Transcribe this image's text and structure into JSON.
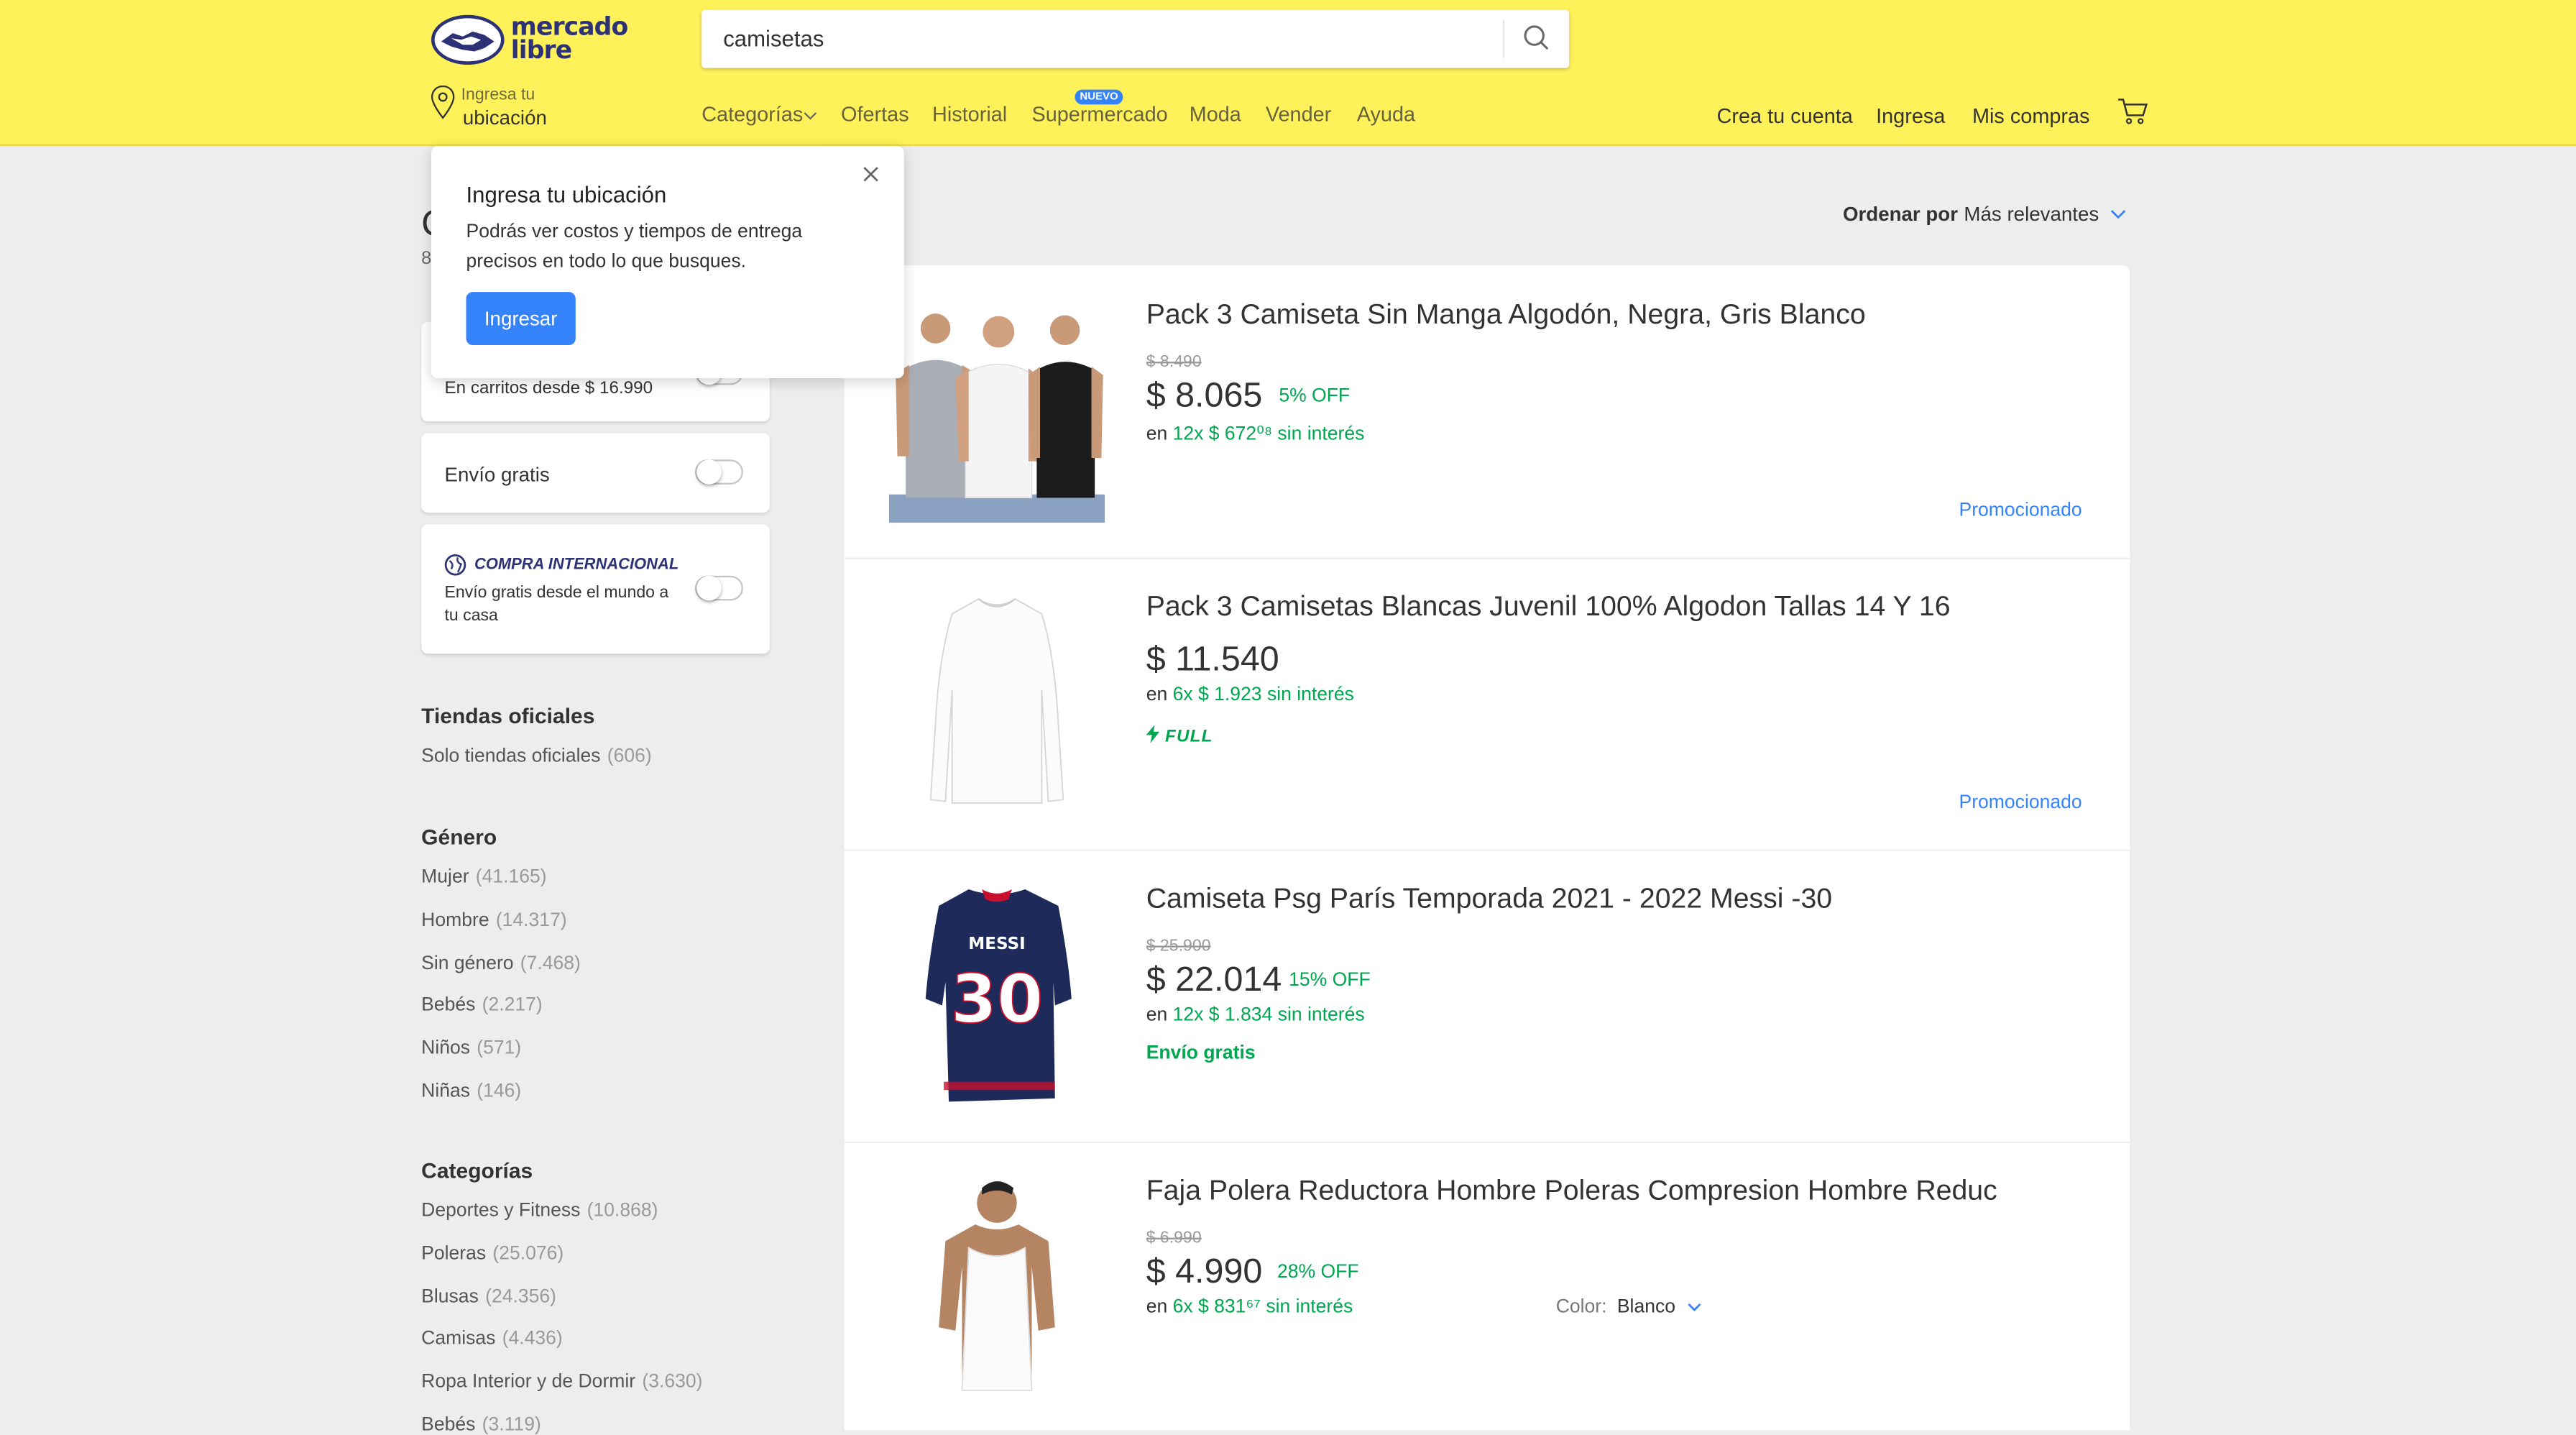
{
  "header": {
    "logo_text": [
      "mercado",
      "libre"
    ],
    "search_value": "camisetas",
    "location_line1": "Ingresa tu",
    "location_line2": "ubicación",
    "nav": [
      "Categorías",
      "Ofertas",
      "Historial",
      "Supermercado",
      "Moda",
      "Vender",
      "Ayuda"
    ],
    "nuevo_badge": "NUEVO",
    "right": [
      "Crea tu cuenta",
      "Ingresa",
      "Mis compras"
    ]
  },
  "popup": {
    "title": "Ingresa tu ubicación",
    "text": "Podrás ver costos y tiempos de entrega precisos en todo lo que busques.",
    "button": "Ingresar"
  },
  "sidebar": {
    "heading_fragment": "C",
    "count_fragment": "8",
    "carritos": "En carritos desde $ 16.990",
    "envio_gratis": "Envío gratis",
    "intl_title": "COMPRA INTERNACIONAL",
    "intl_text": "Envío gratis desde el mundo a tu casa",
    "tiendas": {
      "title": "Tiendas oficiales",
      "items": [
        {
          "label": "Solo tiendas oficiales",
          "count": "(606)"
        }
      ]
    },
    "genero": {
      "title": "Género",
      "items": [
        {
          "label": "Mujer",
          "count": "(41.165)"
        },
        {
          "label": "Hombre",
          "count": "(14.317)"
        },
        {
          "label": "Sin género",
          "count": "(7.468)"
        },
        {
          "label": "Bebés",
          "count": "(2.217)"
        },
        {
          "label": "Niños",
          "count": "(571)"
        },
        {
          "label": "Niñas",
          "count": "(146)"
        }
      ]
    },
    "categorias": {
      "title": "Categorías",
      "items": [
        {
          "label": "Deportes y Fitness",
          "count": "(10.868)"
        },
        {
          "label": "Poleras",
          "count": "(25.076)"
        },
        {
          "label": "Blusas",
          "count": "(24.356)"
        },
        {
          "label": "Camisas",
          "count": "(4.436)"
        },
        {
          "label": "Ropa Interior y de Dormir",
          "count": "(3.630)"
        },
        {
          "label": "Bebés",
          "count": "(3.119)"
        }
      ]
    }
  },
  "sort": {
    "label": "Ordenar por",
    "value": "Más relevantes"
  },
  "results": [
    {
      "title": "Pack 3 Camiseta Sin Manga Algodón, Negra, Gris Blanco",
      "old_price": "$ 8.490",
      "price": "$ 8.065",
      "discount": "5% OFF",
      "inst_prefix": "en",
      "installments": "12x $ 672⁰⁸ sin interés",
      "promo": "Promocionado"
    },
    {
      "title": "Pack 3 Camisetas Blancas Juvenil 100% Algodon Tallas 14 Y 16",
      "price": "$ 11.540",
      "inst_prefix": "en",
      "installments": "6x $ 1.923 sin interés",
      "full": "FULL",
      "promo": "Promocionado"
    },
    {
      "title": "Camiseta Psg París Temporada 2021 - 2022 Messi -30",
      "old_price": "$ 25.900",
      "price": "$ 22.014",
      "discount": "15% OFF",
      "inst_prefix": "en",
      "installments": "12x $ 1.834 sin interés",
      "shipping": "Envío gratis",
      "jersey_name": "MESSI",
      "jersey_number": "30"
    },
    {
      "title": "Faja Polera Reductora Hombre Poleras Compresion Hombre Reduc",
      "old_price": "$ 6.990",
      "price": "$ 4.990",
      "discount": "28% OFF",
      "inst_prefix": "en",
      "installments": "6x $ 831⁶⁷ sin interés",
      "color_label": "Color:",
      "color_value": "Blanco"
    }
  ],
  "colors": {
    "header_bg": "#fff159",
    "brand_blue": "#2d3277",
    "accent": "#3483fa",
    "green": "#00a650"
  }
}
